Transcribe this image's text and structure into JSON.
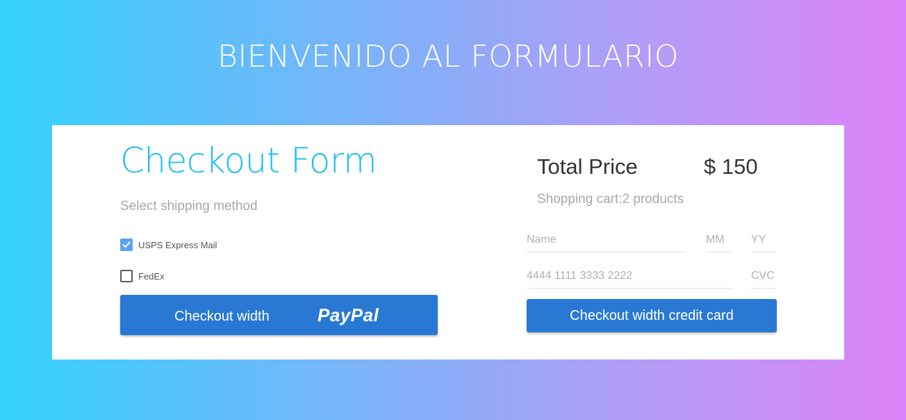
{
  "page": {
    "title": "BIENVENIDO AL FORMULARIO",
    "background_gradient": [
      "#34d2fd",
      "#db82f7"
    ]
  },
  "checkout": {
    "heading": "Checkout Form",
    "shipping_label": "Select shipping method",
    "shipping_options": [
      {
        "label": "USPS Express Mail",
        "checked": true
      },
      {
        "label": "FedEx",
        "checked": false
      }
    ],
    "paypal_button": {
      "label": "Checkout width",
      "logo_text": "PayPal"
    }
  },
  "summary": {
    "total_label": "Total Price",
    "total_value": "$ 150",
    "cart_info": "Shopping cart:2 products"
  },
  "card_form": {
    "name_placeholder": "Name",
    "mm_placeholder": "MM",
    "yy_placeholder": "YY",
    "card_number_placeholder": "4444 1111 3333 2222",
    "cvc_placeholder": "CVC",
    "submit_label": "Checkout width credit card"
  },
  "colors": {
    "accent": "#1ebfef",
    "button": "#2979d4",
    "checkbox_checked": "#5aa3f0",
    "muted_text": "#a8a8a8"
  },
  "icons": {
    "checkmark": "check-icon"
  }
}
